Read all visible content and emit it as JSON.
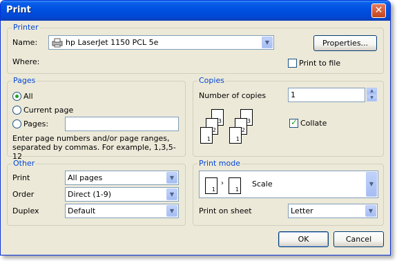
{
  "window": {
    "title": "Print",
    "close_glyph": "✕"
  },
  "printer": {
    "group_title": "Printer",
    "name_label": "Name:",
    "name_value": "hp LaserJet 1150 PCL 5e",
    "properties_button": "Properties...",
    "where_label": "Where:",
    "print_to_file_label": "Print to file",
    "print_to_file_checked": false
  },
  "pages": {
    "group_title": "Pages",
    "options": [
      {
        "label": "All",
        "selected": true
      },
      {
        "label": "Current page",
        "selected": false
      },
      {
        "label": "Pages:",
        "selected": false
      }
    ],
    "pages_input_value": "",
    "hint": "Enter page numbers and/or page ranges, separated by commas. For example, 1,3,5-12"
  },
  "copies": {
    "group_title": "Copies",
    "number_label": "Number of copies",
    "number_value": "1",
    "collate_label": "Collate",
    "collate_checked": true,
    "page_numbers": [
      "1",
      "2",
      "3"
    ]
  },
  "other": {
    "group_title": "Other",
    "print_label": "Print",
    "print_value": "All pages",
    "order_label": "Order",
    "order_value": "Direct (1-9)",
    "duplex_label": "Duplex",
    "duplex_value": "Default"
  },
  "print_mode": {
    "group_title": "Print mode",
    "mode_value": "Scale",
    "mode_page_numbers": [
      "1",
      "1"
    ],
    "sheet_label": "Print on sheet",
    "sheet_value": "Letter"
  },
  "footer": {
    "ok_label": "OK",
    "cancel_label": "Cancel"
  }
}
